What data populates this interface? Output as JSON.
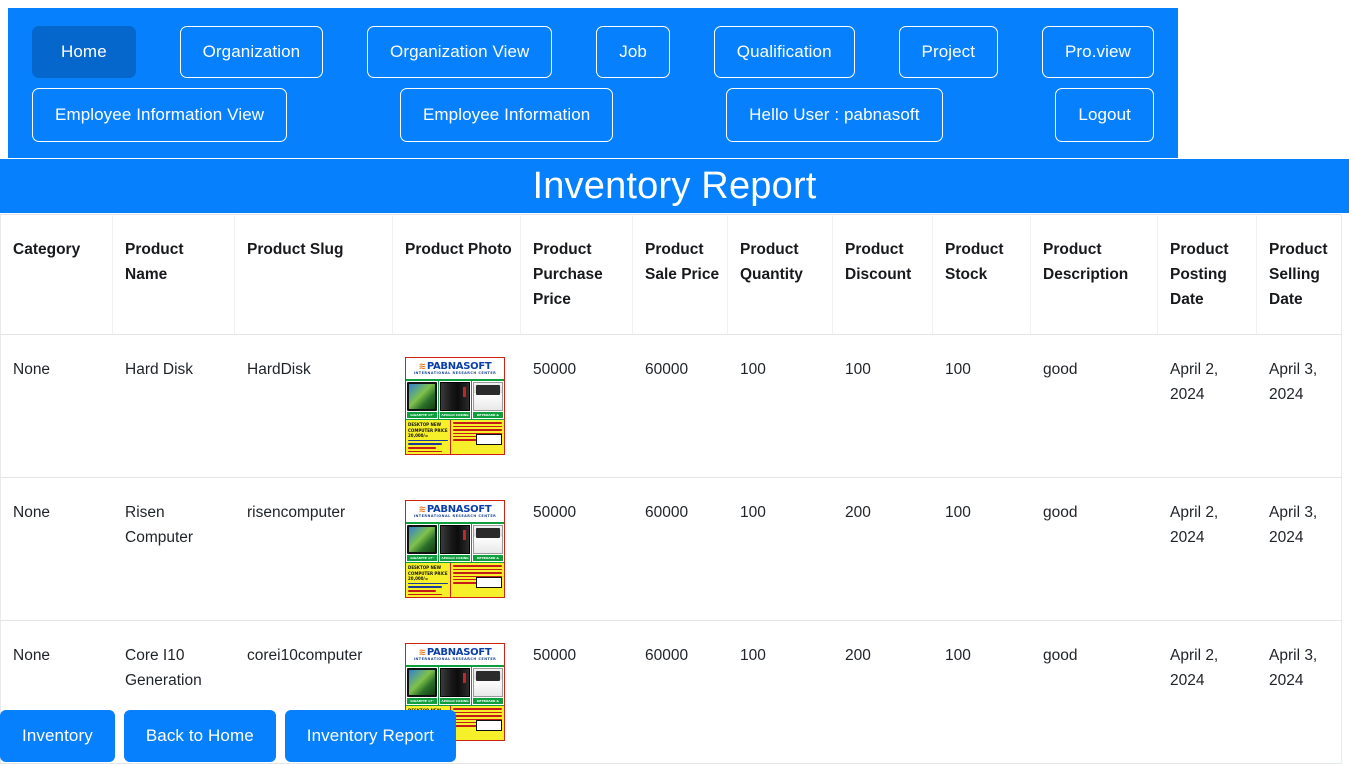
{
  "theme": {
    "primary": "#0680fc",
    "primary_active": "#0566cb",
    "text": "#1f2328",
    "border": "#e3e5e8"
  },
  "navbar": {
    "row1": [
      {
        "label": "Home",
        "active": true
      },
      {
        "label": "Organization",
        "active": false
      },
      {
        "label": "Organization View",
        "active": false
      },
      {
        "label": "Job",
        "active": false
      },
      {
        "label": "Qualification",
        "active": false
      },
      {
        "label": "Project",
        "active": false
      },
      {
        "label": "Pro.view",
        "active": false
      }
    ],
    "row2": [
      {
        "label": "Employee Information View",
        "active": false
      },
      {
        "label": "Employee Information",
        "active": false
      },
      {
        "label": "Hello User : pabnasoft",
        "active": false
      },
      {
        "label": "Logout",
        "active": false
      }
    ]
  },
  "header": {
    "title": "Inventory Report"
  },
  "table": {
    "columns": [
      "Category",
      "Product Name",
      "Product Slug",
      "Product Photo",
      "Product Purchase Price",
      "Product Sale Price",
      "Product Quantity",
      "Product Discount",
      "Product Stock",
      "Product Description",
      "Product Posting Date",
      "Product Selling Date"
    ],
    "rows": [
      {
        "category": "None",
        "product_name": "Hard Disk",
        "product_slug": "HardDisk",
        "product_photo": "pabnasoft-computer-flyer-image",
        "purchase_price": "50000",
        "sale_price": "60000",
        "quantity": "100",
        "discount": "100",
        "stock": "100",
        "description": "good",
        "posting_date": "April 2, 2024",
        "selling_date": "April 3, 2024"
      },
      {
        "category": "None",
        "product_name": "Risen Computer",
        "product_slug": "risencomputer",
        "product_photo": "pabnasoft-computer-flyer-image",
        "purchase_price": "50000",
        "sale_price": "60000",
        "quantity": "100",
        "discount": "200",
        "stock": "100",
        "description": "good",
        "posting_date": "April 2, 2024",
        "selling_date": "April 3, 2024"
      },
      {
        "category": "None",
        "product_name": "Core I10 Generation",
        "product_slug": "corei10computer",
        "product_photo": "pabnasoft-computer-flyer-image",
        "purchase_price": "50000",
        "sale_price": "60000",
        "quantity": "100",
        "discount": "200",
        "stock": "100",
        "description": "good",
        "posting_date": "April 2, 2024",
        "selling_date": "April 3, 2024"
      }
    ]
  },
  "flyer": {
    "brand": "PABNASOFT",
    "tagline": "INTERNATIONAL RESEARCH CENTER",
    "captions": [
      "GIGABYTE 17\" MONITOR",
      "APOLLO CASING",
      "KEYBOARD & MOUSE"
    ],
    "offer_title": "DESKTOP NEW COMPUTER PRICE 20,000/="
  },
  "actions": [
    {
      "label": "Inventory"
    },
    {
      "label": "Back to Home"
    },
    {
      "label": "Inventory Report"
    }
  ]
}
